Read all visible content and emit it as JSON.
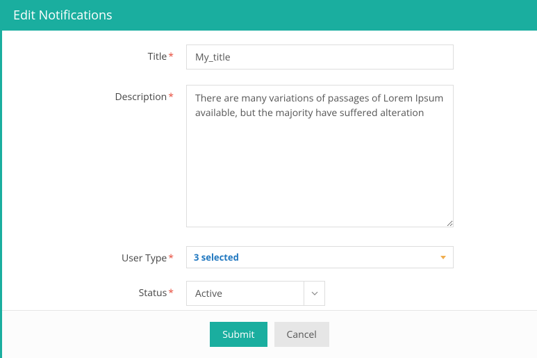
{
  "header": {
    "title": "Edit Notifications"
  },
  "form": {
    "title": {
      "label": "Title",
      "value": "My_title"
    },
    "description": {
      "label": "Description",
      "value": "There are many variations of passages of Lorem Ipsum available, but the majority have suffered alteration"
    },
    "userType": {
      "label": "User Type",
      "selectedText": "3 selected"
    },
    "status": {
      "label": "Status",
      "value": "Active"
    }
  },
  "footer": {
    "submit": "Submit",
    "cancel": "Cancel"
  }
}
